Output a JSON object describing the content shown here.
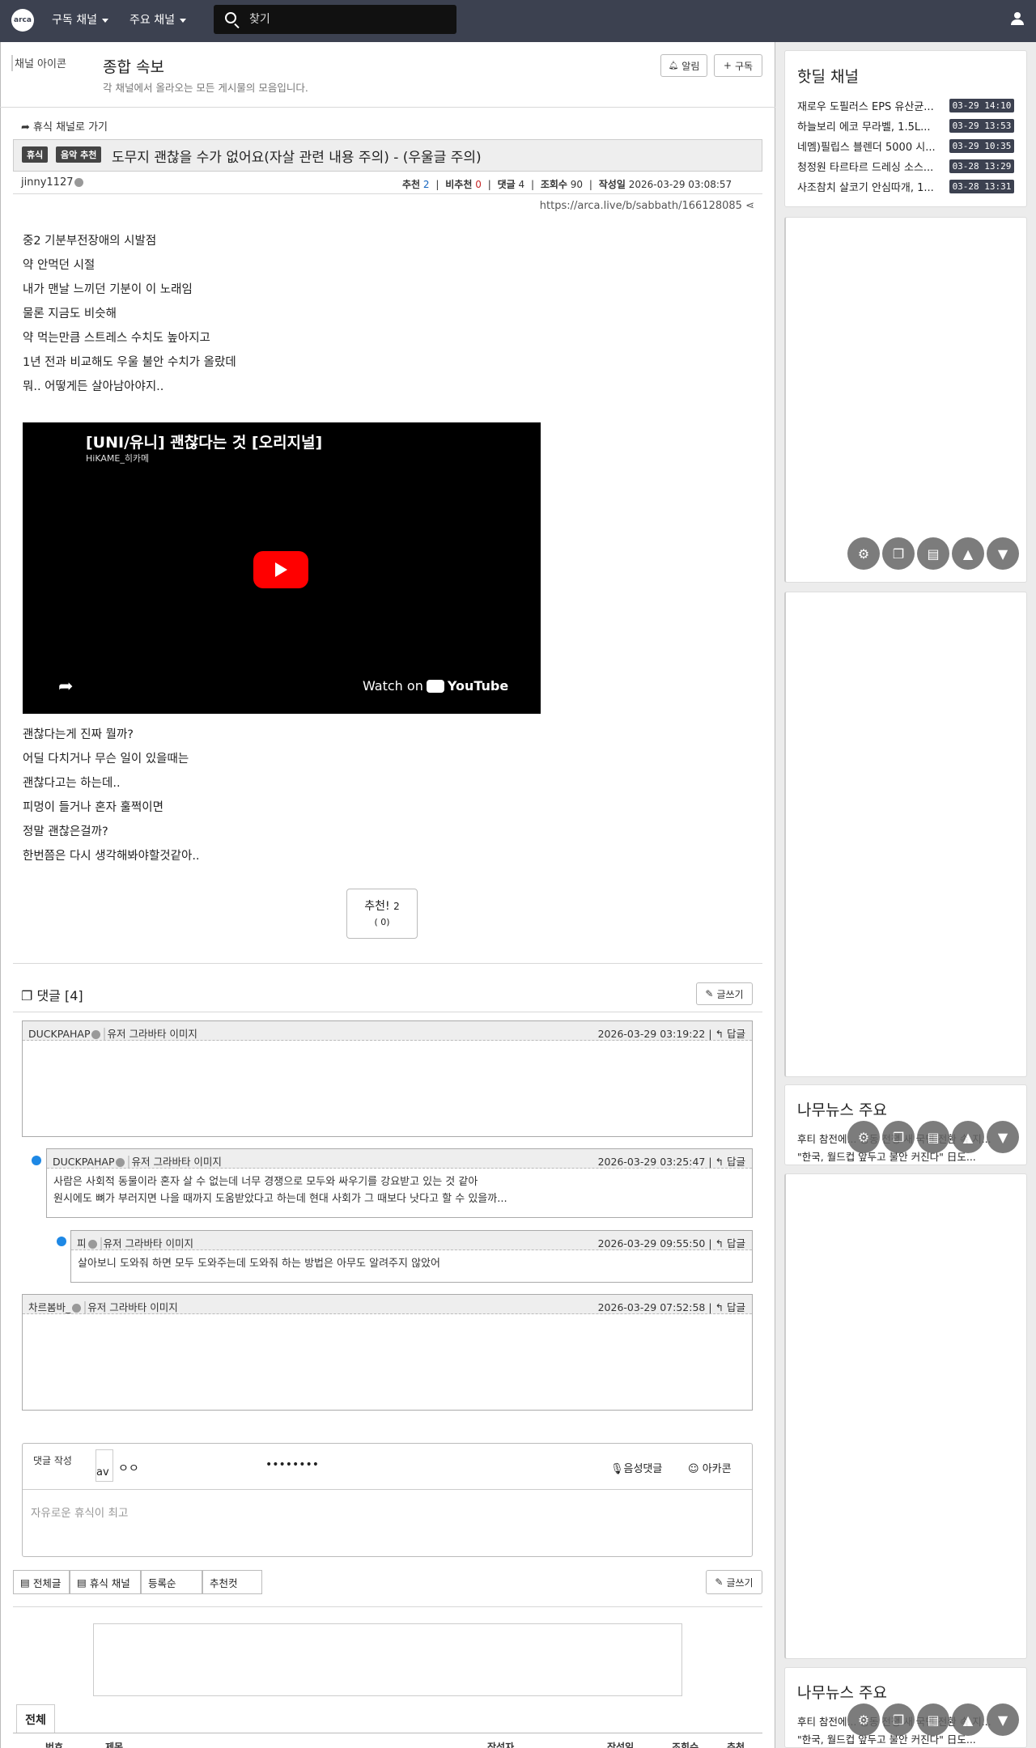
{
  "nav": {
    "logo": "arca",
    "menu1": "구독 채널",
    "menu2": "주요 채널",
    "search_placeholder": "찾기"
  },
  "board": {
    "icon_alt": "채널 아이콘",
    "title": "종합 속보",
    "desc": "각 채널에서 올라오는 모든 게시물의 모음입니다.",
    "notify": "알림",
    "subscribe": "구독"
  },
  "article": {
    "back": "휴식 채널로 가기",
    "badge1": "휴식",
    "badge2": "음악 추천",
    "title": "도무지 괜찮을 수가 없어요(자살 관련 내용 주의) - (우울글 주의)",
    "author": "jinny1127",
    "rec_label": "추천",
    "rec": "2",
    "nrec_label": "비추천",
    "nrec": "0",
    "cmt_label": "댓글",
    "cmt": "4",
    "view_label": "조회수",
    "view": "90",
    "date_label": "작성일",
    "date": "2026-03-29 03:08:57",
    "url": "https://arca.live/b/sabbath/166128085",
    "lines1": [
      "중2 기분부전장애의 시발점",
      "약 안먹던 시절",
      "내가 맨날 느끼던 기분이 이 노래임",
      "물론 지금도 비슷해",
      "약 먹는만큼 스트레스 수치도 높아지고",
      "1년 전과 비교해도 우울 불안 수치가 올랐데",
      "뭐.. 어떻게든 살아남아야지.."
    ],
    "video_title": "[UNI/유니] 괜찮다는 것 [오리지널]",
    "video_channel": "HiKAME_히카메",
    "video_watch": "Watch on",
    "video_yt": "YouTube",
    "lines2": [
      "괜찮다는게 진짜 뭘까?",
      "어딜 다치거나 무슨 일이 있을때는",
      "괜찮다고는 하는데..",
      "피멍이 들거나 혼자 훌쩍이면",
      "정말 괜찮은걸까?",
      "한번쯤은 다시 생각해봐야할것같아.."
    ],
    "vote_label": "추천!",
    "vote_count": "2",
    "vote_sub": "( 0)"
  },
  "comments": {
    "header": "댓글 [4]",
    "write": "글쓰기",
    "avatar_alt": "유저 그라바타 이미지",
    "reply": "답글",
    "items": [
      {
        "author": "DUCKPAHAP",
        "date": "2026-03-29 03:19:22",
        "text": ""
      },
      {
        "author": "DUCKPAHAP",
        "date": "2026-03-29 03:25:47",
        "text1": "사람은 사회적 동물이라 혼자 살 수 없는데 너무 경쟁으로 모두와 싸우기를 강요받고 있는 것 같아",
        "text2": "원시에도 뼈가 부러지면 나을 때까지 도움받았다고 하는데 현대 사회가 그 때보다 낫다고 할 수 있을까..."
      },
      {
        "author": "피",
        "date": "2026-03-29 09:55:50",
        "text1": "살아보니 도와줘 하면 모두 도와주는데 도와줘 하는 방법은 아무도 알려주지 않았어"
      },
      {
        "author": "차르봄바_",
        "date": "2026-03-29 07:52:58",
        "text": ""
      }
    ],
    "form_label": "댓글 작성",
    "form_avatar": "av",
    "form_name": "ㅇㅇ",
    "form_password": "••••••••",
    "voice": "음성댓글",
    "arcacon": "아카콘",
    "placeholder": "자유로운 휴식이 최고"
  },
  "bottom": {
    "all": "전체글",
    "channel": "휴식 채널",
    "order": "등록순",
    "recommend": "추천컷",
    "write": "글쓰기",
    "tab_all": "전체",
    "th_no": "번호",
    "th_title": "제목",
    "th_author": "작성자",
    "th_date": "작성일",
    "th_views": "조회수",
    "th_rec": "추천"
  },
  "sidebar": {
    "hot_title": "핫딜 채널",
    "hot": [
      {
        "title": "재로우 도필러스 EPS 유산균...",
        "date": "03-29 14:10"
      },
      {
        "title": "하늘보리 에코 무라벨, 1.5L...",
        "date": "03-29 13:53"
      },
      {
        "title": "네멤)필립스 블렌더 5000 시...",
        "date": "03-29 10:35"
      },
      {
        "title": "청정원 타르타르 드레싱 소스...",
        "date": "03-28 13:29"
      },
      {
        "title": "사조참치 살코기 안심따개, 1...",
        "date": "03-28 13:31"
      }
    ],
    "news_title": "나무뉴스 주요",
    "news1": "후티 참전에... 중동 전쟁 새 국면 전환 속 지...",
    "news2": "\"한국, 월드컵 앞두고 불안 커진다\" 日도...",
    "news1b": "후티 참전에... 중동 전쟁 새 국면 전환 속 지...",
    "news2b": "\"한국, 월드컵 앞두고 불안 커진다\" 日도..."
  }
}
